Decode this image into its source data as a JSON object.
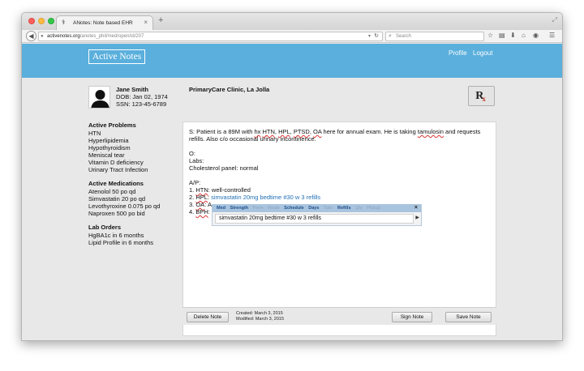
{
  "browser": {
    "tab_title": "ANotes: Note based EHR",
    "tab_close": "×",
    "new_tab": "+",
    "url_host": "activenotes.org",
    "url_path": "/anotes_phil/med/open/id/207",
    "search_placeholder": "Search",
    "icons": [
      "star-icon",
      "reading-list-icon",
      "download-icon",
      "home-icon",
      "chat-icon",
      "menu-icon"
    ]
  },
  "header": {
    "logo": "Active Notes",
    "nav": {
      "profile": "Profile",
      "logout": "Logout"
    },
    "color": "#5aafdc"
  },
  "patient": {
    "name": "Jane Smith",
    "dob": "DOB: Jan 02, 1974",
    "ssn": "SSN: 123-45-6789",
    "clinic": "PrimaryCare Clinic, La Jolla"
  },
  "rx_button": {
    "label": "R",
    "mark": "x"
  },
  "sidebar": {
    "problems": {
      "heading": "Active Problems",
      "items": [
        "HTN",
        "Hyperlipidemia",
        "Hypothyroidism",
        "Meniscal tear",
        "Vitamin D deficiency",
        "Urinary Tract Infection"
      ]
    },
    "medications": {
      "heading": "Active Medications",
      "items": [
        "Atenolol 50 po qd",
        "Simvastatin 20 po qd",
        "Levothyroxine 0.075 po qd",
        "Naproxen 500 po bid"
      ]
    },
    "lab_orders": {
      "heading": "Lab Orders",
      "items": [
        "HgBA1c in 6 months",
        "Lipid Profile in 6 months"
      ]
    }
  },
  "note": {
    "s_prefix": "S: Patient is a 89M with ",
    "s_hx": "hx",
    "s_htn": "HTN",
    "s_hpl": "HPL",
    "s_ptsd": "PTSD",
    "s_oa": "OA",
    "s_mid": " here for annual exam. He is taking ",
    "s_tamulosin": "tamulosin",
    "s_end": " and requests",
    "s_line2": "refills. Also c/o occasional urinary incontinence.",
    "o_heading": "O:",
    "labs": "Labs:",
    "cholesterol": "Cholesterol panel: normal",
    "ap_heading": "A/P:",
    "ap1_num": "1. ",
    "ap1_term": "HTN",
    "ap1_rest": ": well-controlled",
    "ap2_num": "2. ",
    "ap2_term": "HPL",
    "ap2_sep": ": ",
    "ap2_med": "simvastatin 20mg bedtime #30 w 3 refills",
    "ap3_num": "3. ",
    "ap3_term": "OA",
    "ap3_rest": ": A",
    "ap4_num": "4. ",
    "ap4_term": "BPH",
    "ap4_rest": ":"
  },
  "autocomplete": {
    "fields": [
      {
        "label": "Med",
        "active": true
      },
      {
        "label": "Strength",
        "active": true
      },
      {
        "label": "Form",
        "active": false
      },
      {
        "label": "Route",
        "active": false
      },
      {
        "label": "Schedule",
        "active": true
      },
      {
        "label": "Days",
        "active": true
      },
      {
        "label": "Take",
        "active": false
      },
      {
        "label": "Refills",
        "active": true
      },
      {
        "label": "Qty",
        "active": false
      },
      {
        "label": "Pickup",
        "active": false
      }
    ],
    "close": "×",
    "value": "simvastatin 20mg bedtime #30 w 3 refills",
    "arrow": "▶"
  },
  "footer": {
    "delete_label": "Delete Note",
    "created": "Created: March 3, 2015",
    "modified": "Modified: March 3, 2015",
    "sign_label": "Sign Note",
    "save_label": "Save Note"
  }
}
